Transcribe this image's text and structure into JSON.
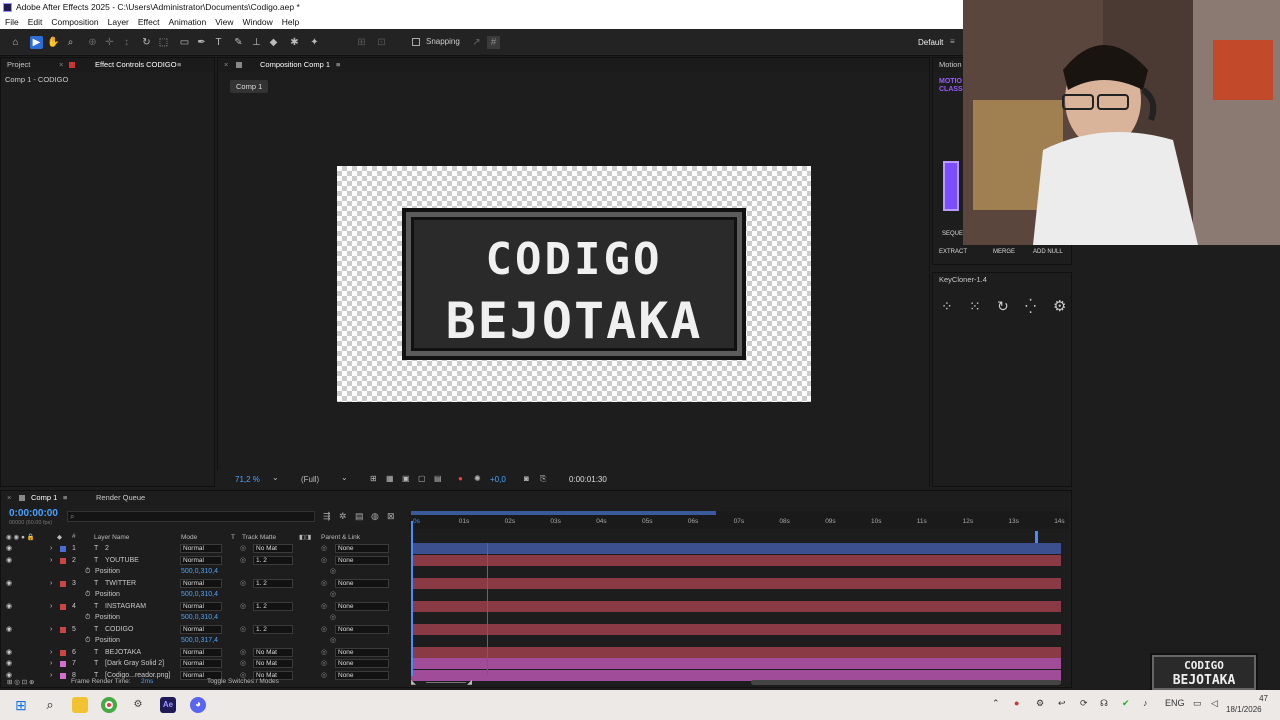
{
  "window": {
    "title": "Adobe After Effects 2025 - C:\\Users\\Administrator\\Documents\\Codigo.aep *"
  },
  "menu": [
    "File",
    "Edit",
    "Composition",
    "Layer",
    "Effect",
    "Animation",
    "View",
    "Window",
    "Help"
  ],
  "toolbar": {
    "snapping_label": "Snapping",
    "workspace": "Default"
  },
  "left_panel": {
    "tab_project": "Project",
    "tab_effect_controls": "Effect Controls CODIGO",
    "subtitle": "Comp 1 - CODIGO"
  },
  "composition": {
    "tab": "Composition Comp 1",
    "crumb": "Comp 1",
    "line1": "CODIGO",
    "line2": "BEJOTAKA"
  },
  "viewer_bar": {
    "zoom": "71,2 %",
    "quality": "(Full)",
    "exposure": "+0,0",
    "timecode": "0:00:01:30"
  },
  "right_panel": {
    "motion_tab": "Motion",
    "motion_logo": "MOTIO CLASS",
    "sequence_label": "SEQUEN",
    "buttons": [
      "EXTRACT",
      "MERGE",
      "ADD NULL"
    ],
    "keycloner_title": "KeyCloner-1.4"
  },
  "timeline": {
    "tab": "Comp 1",
    "render_queue": "Render Queue",
    "timecode": "0:00:00:00",
    "fps": "00000 (60.00 fps)",
    "columns": {
      "num": "#",
      "layer_name": "Layer Name",
      "mode": "Mode",
      "t": "T",
      "track_matte": "Track Matte",
      "parent": "Parent & Link"
    },
    "ruler": [
      "0s",
      "01s",
      "02s",
      "03s",
      "04s",
      "05s",
      "06s",
      "07s",
      "08s",
      "09s",
      "10s",
      "11s",
      "12s",
      "13s",
      "14s"
    ],
    "footer": {
      "frame_render": "Frame Render Time:",
      "frame_render_value": "2ms",
      "toggle": "Toggle Switches / Modes"
    }
  },
  "layers": [
    {
      "num": "1",
      "name": "2",
      "mode": "Normal",
      "matte": "No Mat",
      "parent": "None",
      "color": "#4b6bd6",
      "bar": "#3c4f8e"
    },
    {
      "num": "2",
      "name": "YOUTUBE",
      "mode": "Normal",
      "matte": "1. 2",
      "parent": "None",
      "color": "#c44",
      "bar": "#8a3a45"
    },
    {
      "prop": "Position",
      "value": "500,0,310,4"
    },
    {
      "num": "3",
      "name": "TWITTER",
      "mode": "Normal",
      "matte": "1. 2",
      "parent": "None",
      "color": "#c44",
      "bar": "#8a3a45"
    },
    {
      "prop": "Position",
      "value": "500,0,310,4"
    },
    {
      "num": "4",
      "name": "INSTAGRAM",
      "mode": "Normal",
      "matte": "1. 2",
      "parent": "None",
      "color": "#c44",
      "bar": "#8a3a45"
    },
    {
      "prop": "Position",
      "value": "500,0,310,4"
    },
    {
      "num": "5",
      "name": "CODIGO",
      "mode": "Normal",
      "matte": "1. 2",
      "parent": "None",
      "color": "#c44",
      "bar": "#8a3a45"
    },
    {
      "prop": "Position",
      "value": "500,0,317,4"
    },
    {
      "num": "6",
      "name": "BEJOTAKA",
      "mode": "Normal",
      "matte": "No Mat",
      "parent": "None",
      "color": "#c44",
      "bar": "#8a3a45"
    },
    {
      "num": "7",
      "name": "[Dark Gray Solid 2]",
      "mode": "Normal",
      "matte": "No Mat",
      "parent": "None",
      "color": "#d46fd0",
      "bar": "#a04c98"
    },
    {
      "num": "8",
      "name": "[Codigo...reador.png]",
      "mode": "Normal",
      "matte": "No Mat",
      "parent": "None",
      "color": "#d46fd0",
      "bar": "#a04c98"
    }
  ],
  "overlay": {
    "line1": "CODIGO",
    "line2": "BEJOTAKA"
  },
  "taskbar": {
    "lang": "ENG",
    "time": "47",
    "date": "18/1/2026"
  }
}
